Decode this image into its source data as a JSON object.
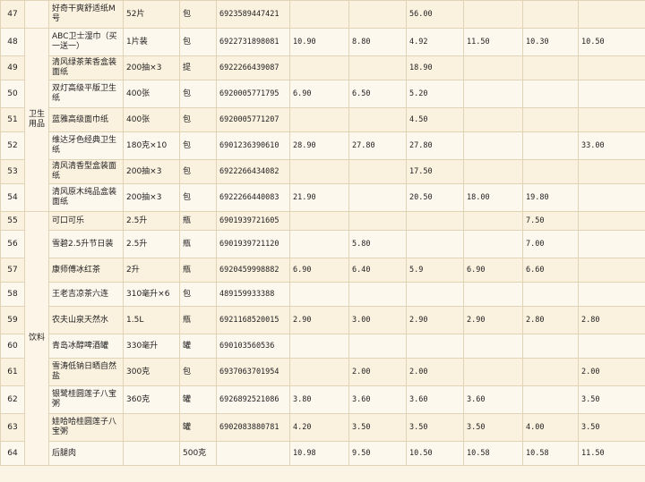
{
  "rows": [
    {
      "no": "47",
      "name": "好奇干爽舒适纸M号",
      "spec": "52片",
      "unit": "包",
      "code": "6923589447421",
      "p": [
        "",
        "",
        "56.00",
        "",
        "",
        ""
      ]
    },
    {
      "no": "48",
      "name": "ABC卫士湿巾（买一送一）",
      "spec": "1片装",
      "unit": "包",
      "code": "6922731898081",
      "p": [
        "10.90",
        "8.80",
        "4.92",
        "11.50",
        "10.30",
        "10.50"
      ]
    },
    {
      "no": "49",
      "name": "清风绿茶茉香盒装面纸",
      "spec": "200抽×3",
      "unit": "提",
      "code": "6922266439087",
      "p": [
        "",
        "",
        "18.90",
        "",
        "",
        ""
      ]
    },
    {
      "no": "50",
      "name": "双灯高级平版卫生纸",
      "spec": "400张",
      "unit": "包",
      "code": "6920005771795",
      "p": [
        "6.90",
        "6.50",
        "5.20",
        "",
        "",
        ""
      ]
    },
    {
      "no": "51",
      "name": "蓝雅高级面巾纸",
      "spec": "400张",
      "unit": "包",
      "code": "6920005771207",
      "p": [
        "",
        "",
        "4.50",
        "",
        "",
        ""
      ]
    },
    {
      "no": "52",
      "name": "维达牙色经典卫生纸",
      "spec": "180克×10",
      "unit": "包",
      "code": "6901236390610",
      "p": [
        "28.90",
        "27.80",
        "27.80",
        "",
        "",
        "33.00"
      ]
    },
    {
      "no": "53",
      "name": "清风清香型盒装面纸",
      "spec": "200抽×3",
      "unit": "包",
      "code": "6922266434082",
      "p": [
        "",
        "",
        "17.50",
        "",
        "",
        ""
      ]
    },
    {
      "no": "54",
      "name": "清风原木纯品盒装面纸",
      "spec": "200抽×3",
      "unit": "包",
      "code": "6922266440083",
      "p": [
        "21.90",
        "",
        "20.50",
        "18.00",
        "19.80",
        ""
      ]
    },
    {
      "no": "55",
      "name": "可口可乐",
      "spec": "2.5升",
      "unit": "瓶",
      "code": "6901939721605",
      "p": [
        "",
        "",
        "",
        "",
        "7.50",
        ""
      ]
    },
    {
      "no": "56",
      "name": "雪碧2.5升节日装",
      "spec": "2.5升",
      "unit": "瓶",
      "code": "6901939721120",
      "p": [
        "",
        "5.80",
        "",
        "",
        "7.00",
        ""
      ]
    },
    {
      "no": "57",
      "name": "康师傅冰红茶",
      "spec": "2升",
      "unit": "瓶",
      "code": "6920459998882",
      "p": [
        "6.90",
        "6.40",
        "5.9",
        "6.90",
        "6.60",
        ""
      ]
    },
    {
      "no": "58",
      "name": "王老吉凉茶六连",
      "spec": "310毫升×6",
      "unit": "包",
      "code": "489159933388",
      "p": [
        "",
        "",
        "",
        "",
        "",
        ""
      ]
    },
    {
      "no": "59",
      "name": "农夫山泉天然水",
      "spec": "1.5L",
      "unit": "瓶",
      "code": "6921168520015",
      "p": [
        "2.90",
        "3.00",
        "2.90",
        "2.90",
        "2.80",
        "2.80"
      ]
    },
    {
      "no": "60",
      "name": "青岛冰醇啤酒罐",
      "spec": "330毫升",
      "unit": "罐",
      "code": "690103560536",
      "p": [
        "",
        "",
        "",
        "",
        "",
        ""
      ]
    },
    {
      "no": "61",
      "name": "雪涛低钠日晒自然盐",
      "spec": "300克",
      "unit": "包",
      "code": "6937063701954",
      "p": [
        "",
        "2.00",
        "2.00",
        "",
        "",
        "2.00"
      ]
    },
    {
      "no": "62",
      "name": "银鹭桂圆莲子八宝粥",
      "spec": "360克",
      "unit": "罐",
      "code": "6926892521086",
      "p": [
        "3.80",
        "3.60",
        "3.60",
        "3.60",
        "",
        "3.50"
      ]
    },
    {
      "no": "63",
      "name": "娃哈哈桂圆莲子八宝粥",
      "spec": "",
      "unit": "罐",
      "code": "6902083880781",
      "p": [
        "4.20",
        "3.50",
        "3.50",
        "3.50",
        "4.00",
        "3.50"
      ]
    },
    {
      "no": "64",
      "name": "后腿肉",
      "spec": "",
      "unit": "500克",
      "code": "",
      "p": [
        "10.98",
        "9.50",
        "10.50",
        "10.58",
        "10.58",
        "11.50"
      ]
    }
  ],
  "categories": {
    "hygiene": "卫生用品",
    "drinks": "饮料"
  }
}
